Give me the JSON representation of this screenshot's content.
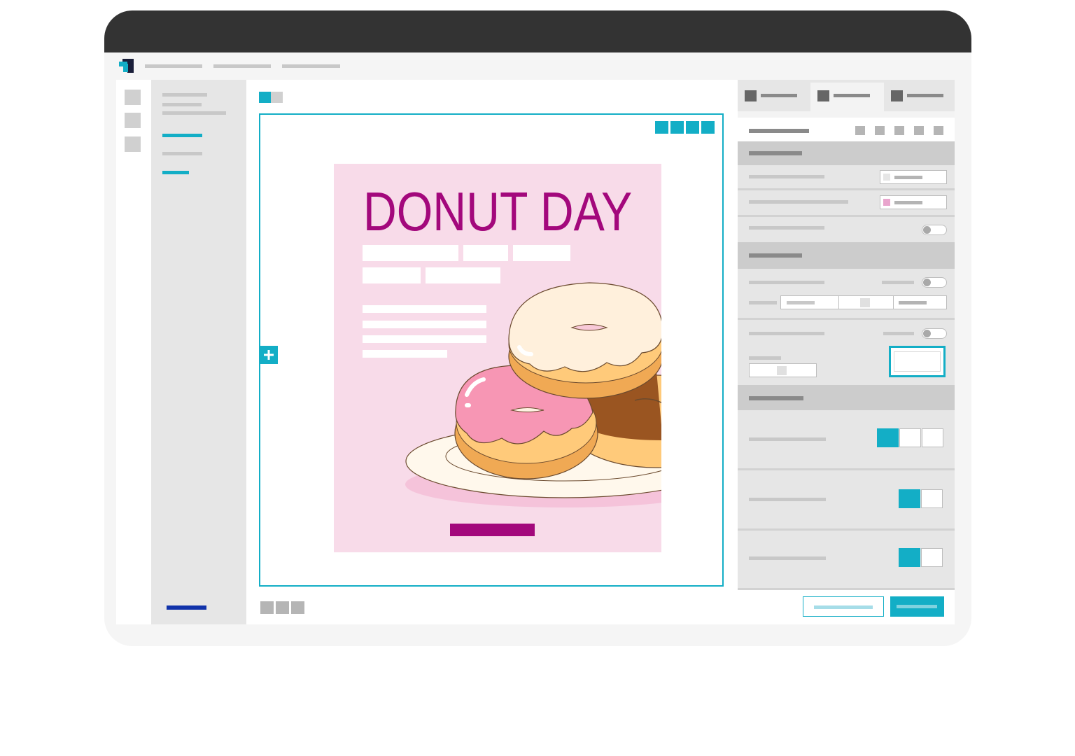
{
  "app": {
    "colors": {
      "accent": "#13aec6",
      "brand_blue": "#1133aa",
      "device_frame": "#333333",
      "poster_bg": "#f8dbe9",
      "poster_title": "#a3087c"
    }
  },
  "canvas": {
    "add_block_icon": "plus-icon"
  },
  "poster": {
    "title": "DONUT DAY",
    "image": "donuts-on-plate-illustration"
  }
}
